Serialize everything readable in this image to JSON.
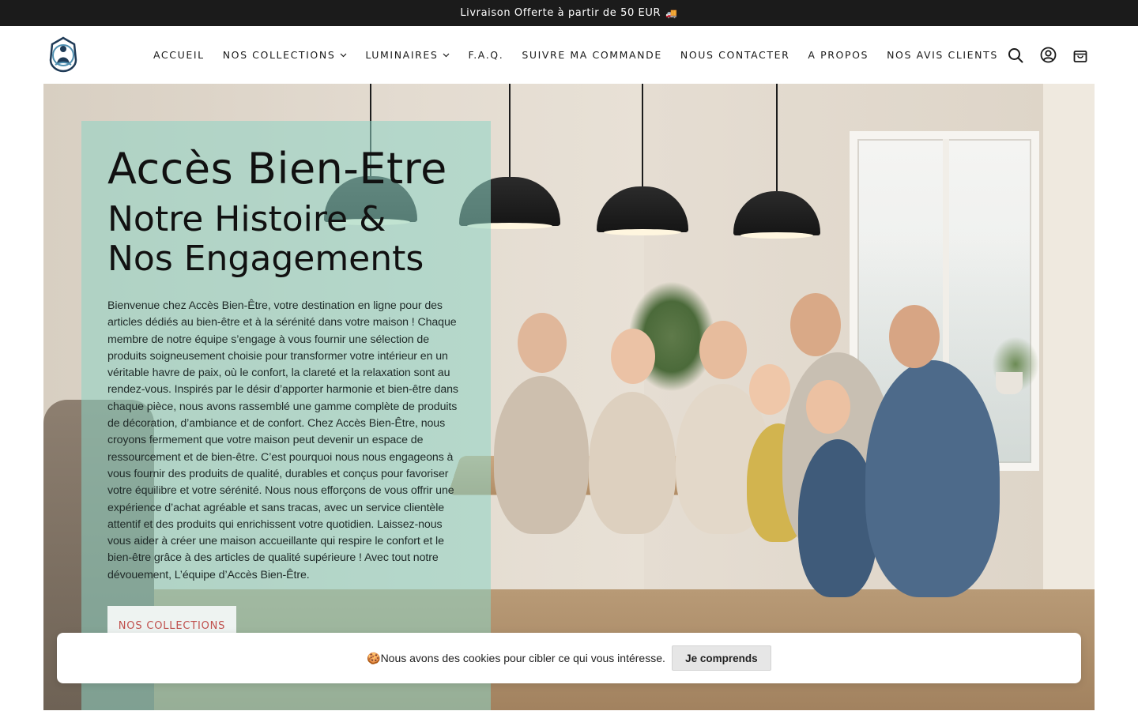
{
  "announcement": {
    "text": "Livraison Offerte à partir de 50 EUR",
    "icon": "truck-icon",
    "glyph": "🚚"
  },
  "header": {
    "logo_icon": "buddha-logo-icon",
    "nav": [
      {
        "label": "ACCUEIL",
        "has_dropdown": false
      },
      {
        "label": "NOS COLLECTIONS",
        "has_dropdown": true
      },
      {
        "label": "LUMINAIRES",
        "has_dropdown": true
      },
      {
        "label": "F.A.Q.",
        "has_dropdown": false
      },
      {
        "label": "SUIVRE MA COMMANDE",
        "has_dropdown": false
      },
      {
        "label": "NOUS CONTACTER",
        "has_dropdown": false
      },
      {
        "label": "A PROPOS",
        "has_dropdown": false
      },
      {
        "label": "NOS AVIS CLIENTS",
        "has_dropdown": false
      }
    ],
    "icons": [
      "search-icon",
      "account-icon",
      "cart-icon"
    ]
  },
  "hero": {
    "title": "Accès Bien-Etre",
    "subtitle_line1": "Notre Histoire &",
    "subtitle_line2": "Nos Engagements",
    "body": "Bienvenue chez Accès Bien-Être, votre destination en ligne pour des articles dédiés au bien-être et à la sérénité dans votre maison ! Chaque membre de notre équipe s’engage à vous fournir une sélection de produits soigneusement choisie pour transformer votre intérieur en un véritable havre de paix, où le confort, la clareté et la relaxation sont au rendez-vous. Inspirés par le désir d’apporter harmonie et bien-être dans chaque pièce, nous avons rassemblé une gamme complète de produits de décoration, d’ambiance et de confort. Chez Accès Bien-Être, nous croyons fermement que votre maison peut devenir un espace de ressourcement et de bien-être. C’est pourquoi nous nous engageons à vous fournir des produits de qualité, durables et conçus pour favoriser votre équilibre et votre sérénité. Nous nous efforçons de vous offrir une expérience d’achat agréable et sans tracas, avec un service clientèle attentif et des produits qui enrichissent votre quotidien. Laissez-nous vous aider à créer une maison accueillante qui respire le confort et le bien-être grâce à des articles de qualité supérieure ! Avec tout notre dévouement, L’équipe d’Accès Bien-Être.",
    "cta_label": "NOS COLLECTIONS",
    "colors": {
      "panel": "#8ed4c4",
      "cta_text": "#c0504d"
    }
  },
  "cookie": {
    "emoji": "🍪",
    "text": "Nous avons des cookies pour cibler ce qui vous intéresse.",
    "button": "Je comprends"
  }
}
